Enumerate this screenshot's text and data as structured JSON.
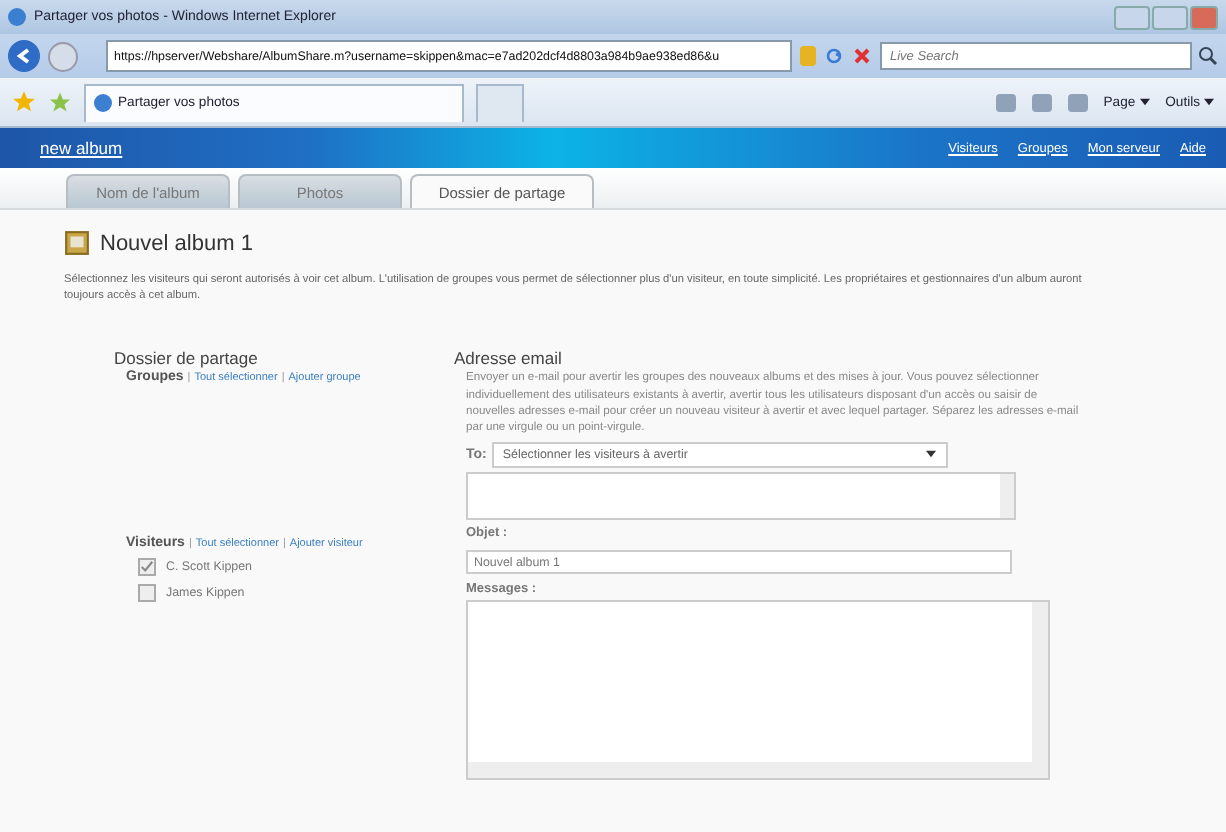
{
  "window": {
    "title": "Partager vos photos - Windows Internet Explorer"
  },
  "address_bar": {
    "url": "https://hpserver/Webshare/AlbumShare.m?username=skippen&mac=e7ad202dcf4d8803a984b9ae938ed86&u"
  },
  "search": {
    "placeholder": "Live Search"
  },
  "browser_tabs": [
    {
      "label": "Partager vos photos",
      "selected": true
    }
  ],
  "command_bar": [
    {
      "label": "Page"
    },
    {
      "label": "Outils"
    }
  ],
  "header": {
    "title": "new album",
    "links": [
      "Visiteurs",
      "Groupes",
      "Mon serveur",
      "Aide"
    ]
  },
  "tabs": [
    {
      "label": "Nom de l'album",
      "selected": false
    },
    {
      "label": "Photos",
      "selected": false
    },
    {
      "label": "Dossier de partage",
      "selected": true
    }
  ],
  "page": {
    "title": "Nouvel album 1",
    "intro": "Sélectionnez les visiteurs qui seront autorisés à voir cet album. L'utilisation de groupes vous permet de sélectionner plus d'un visiteur, en toute simplicité. Les propriétaires et gestionnaires d'un album auront toujours accès à cet album."
  },
  "sharing": {
    "heading": "Dossier de partage",
    "separator": "|",
    "groups": {
      "label": "Groupes",
      "actions": [
        "Tout sélectionner",
        "Ajouter groupe"
      ]
    },
    "visitors": {
      "label": "Visiteurs",
      "actions": [
        "Tout sélectionner",
        "Ajouter visiteur"
      ],
      "items": [
        {
          "name": "C. Scott Kippen",
          "checked": true
        },
        {
          "name": "James Kippen",
          "checked": false
        }
      ]
    }
  },
  "email": {
    "heading": "Adresse email",
    "description": "Envoyer un e-mail pour avertir les groupes des nouveaux albums et des mises à jour. Vous pouvez sélectionner individuellement des utilisateurs existants à avertir, avertir tous les utilisateurs disposant d'un accès ou saisir de nouvelles adresses e-mail pour créer un nouveau visiteur à avertir et avec lequel partager. Séparez les adresses e-mail par une virgule ou un point-virgule.",
    "to": {
      "label": "To:",
      "value": "Sélectionner les visiteurs à avertir"
    },
    "subject": {
      "label": "Objet :",
      "value": "Nouvel album 1"
    },
    "message": {
      "label": "Messages :"
    }
  }
}
